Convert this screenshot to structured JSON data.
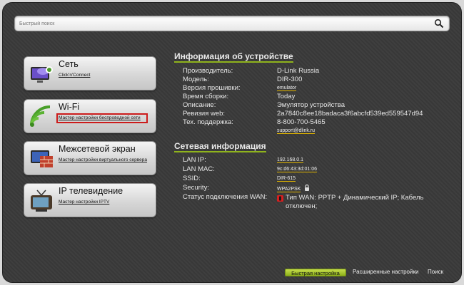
{
  "search": {
    "placeholder": "Быстрый поиск"
  },
  "menu": [
    {
      "title": "Сеть",
      "link": "Click'n'Connect"
    },
    {
      "title": "Wi-Fi",
      "link": "Мастер настройки беспроводной сети"
    },
    {
      "title": "Межсетевой экран",
      "link": "Мастер настройки виртуального сервера"
    },
    {
      "title": "IP телевидение",
      "link": "Мастер настройки IPTV"
    }
  ],
  "device_info": {
    "title": "Информация об устройстве",
    "rows": [
      {
        "label": "Производитель:",
        "value": "D-Link Russia"
      },
      {
        "label": "Модель:",
        "value": "DIR-300"
      },
      {
        "label": "Версия прошивки:",
        "value": "emulator"
      },
      {
        "label": "Время сборки:",
        "value": "Today"
      },
      {
        "label": "Описание:",
        "value": "Эмулятор устройства"
      },
      {
        "label": "Ревизия web:",
        "value": "2a7840c8ee18badaca3f6abcfd539ed559547d94"
      },
      {
        "label": "Тех. поддержка:",
        "value": "8-800-700-5465"
      },
      {
        "label": "",
        "value": "support@dlink.ru"
      }
    ]
  },
  "network_info": {
    "title": "Сетевая информация",
    "rows": [
      {
        "label": "LAN IP:",
        "value": "192.168.0.1"
      },
      {
        "label": "LAN MAC:",
        "value": "9c:d6:43:3d:01:06"
      },
      {
        "label": "SSID:",
        "value": "DIR-615"
      },
      {
        "label": "Security:",
        "value": "WPA2PSK"
      },
      {
        "label": "Статус подключения WAN:",
        "value": "Тип WAN: PPTP + Динамический IP; Кабель отключен;"
      }
    ]
  },
  "bottom_nav": {
    "quick": "Быстрая настройка",
    "advanced": "Расширенные настройки",
    "search": "Поиск"
  },
  "colors": {
    "accent": "#8fb31c",
    "link_underline": "#e0b400",
    "highlight": "#cc1b1b"
  }
}
